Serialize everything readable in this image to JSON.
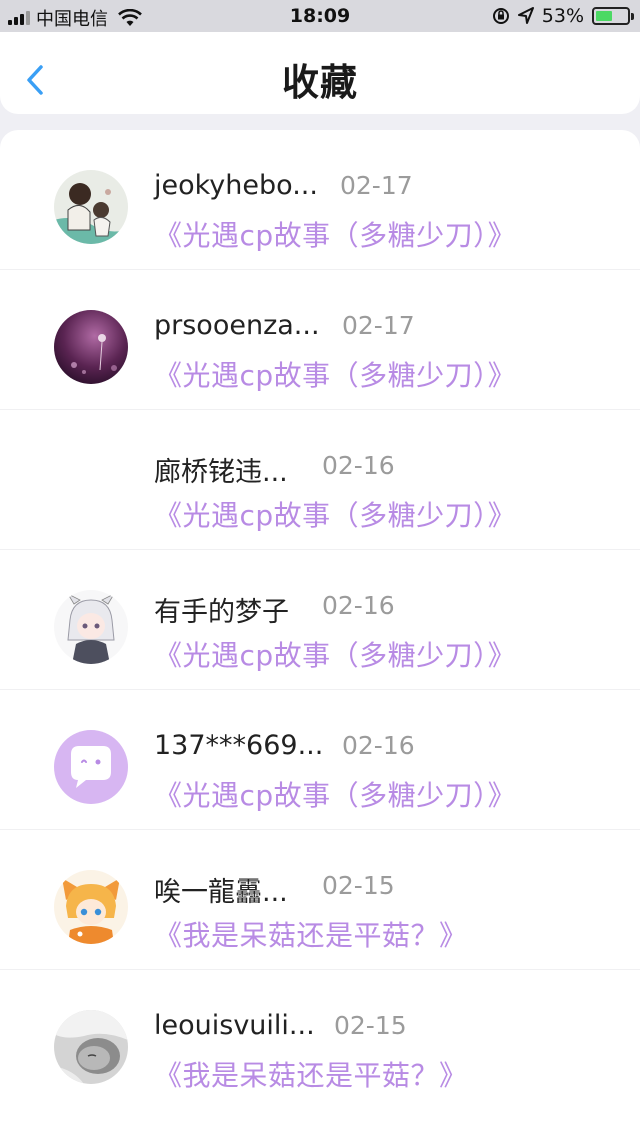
{
  "status_bar": {
    "carrier": "中国电信",
    "time": "18:09",
    "battery_percent": "53%",
    "battery_level": 0.53,
    "icons": [
      "signal-icon",
      "wifi-icon",
      "orientation-lock-icon",
      "location-icon",
      "battery-icon"
    ]
  },
  "header": {
    "back_icon": "chevron-left-icon",
    "title": "收藏"
  },
  "colors": {
    "accent": "#3a9ff5",
    "link": "#b88be4",
    "date": "#9b9b9b",
    "battery": "#4cd964"
  },
  "favorites": [
    {
      "user": "jeokyhebo...",
      "date": "02-17",
      "title": "《光遇cp故事（多糖少刀）》",
      "avatar": "cartoon-couple-avatar"
    },
    {
      "user": "prsooenza...",
      "date": "02-17",
      "title": "《光遇cp故事（多糖少刀）》",
      "avatar": "dandelion-photo-avatar"
    },
    {
      "user": "廊桥铑违...",
      "date": "02-16",
      "title": "《光遇cp故事（多糖少刀）》",
      "avatar": "blank-avatar"
    },
    {
      "user": "有手的梦子",
      "date": "02-16",
      "title": "《光遇cp故事（多糖少刀）》",
      "avatar": "anime-girl-avatar"
    },
    {
      "user": "137***669...",
      "date": "02-16",
      "title": "《光遇cp故事（多糖少刀）》",
      "avatar": "default-chat-bubble-avatar"
    },
    {
      "user": "唉一龍靐...",
      "date": "02-15",
      "title": "《我是呆菇还是平菇？》",
      "avatar": "anime-fox-boy-avatar"
    },
    {
      "user": "leouisvuili...",
      "date": "02-15",
      "title": "《我是呆菇还是平菇？》",
      "avatar": "sleeping-person-photo-avatar"
    }
  ]
}
